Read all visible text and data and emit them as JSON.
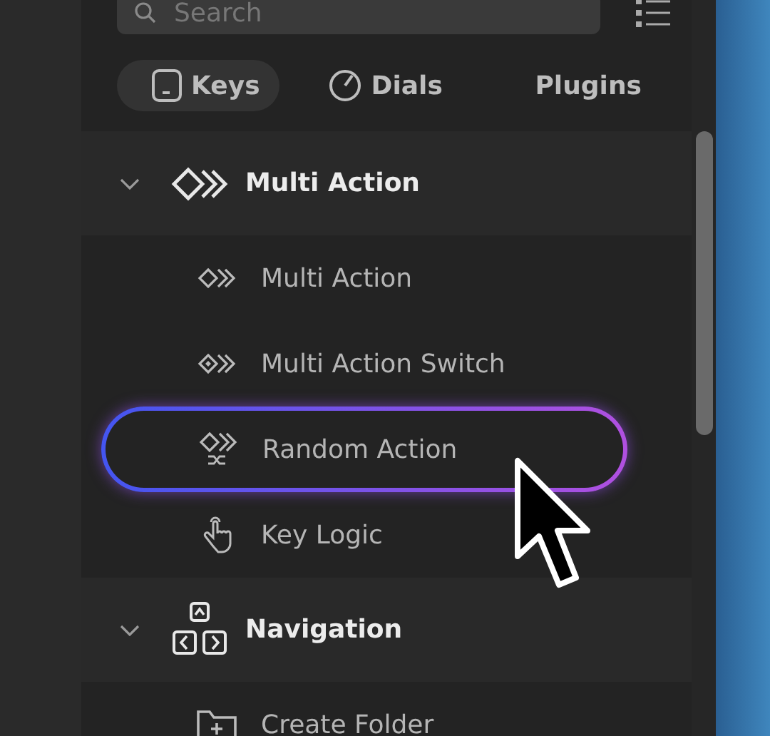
{
  "search": {
    "placeholder": "Search"
  },
  "tabs": [
    {
      "label": "Keys",
      "kind": "key",
      "selected": true
    },
    {
      "label": "Dials",
      "kind": "dial",
      "selected": false
    },
    {
      "label": "Plugins",
      "kind": "plain",
      "selected": false
    }
  ],
  "sections": [
    {
      "title": "Multi Action",
      "kind": "multi",
      "expanded": true,
      "items": [
        {
          "label": "Multi Action",
          "kind": "multi",
          "highlighted": false
        },
        {
          "label": "Multi Action Switch",
          "kind": "switch",
          "highlighted": false
        },
        {
          "label": "Random Action",
          "kind": "random",
          "highlighted": true
        },
        {
          "label": "Key Logic",
          "kind": "hand",
          "highlighted": false
        }
      ]
    },
    {
      "title": "Navigation",
      "kind": "nav",
      "expanded": true,
      "items": [
        {
          "label": "Create Folder",
          "kind": "folder",
          "highlighted": false
        }
      ]
    }
  ]
}
